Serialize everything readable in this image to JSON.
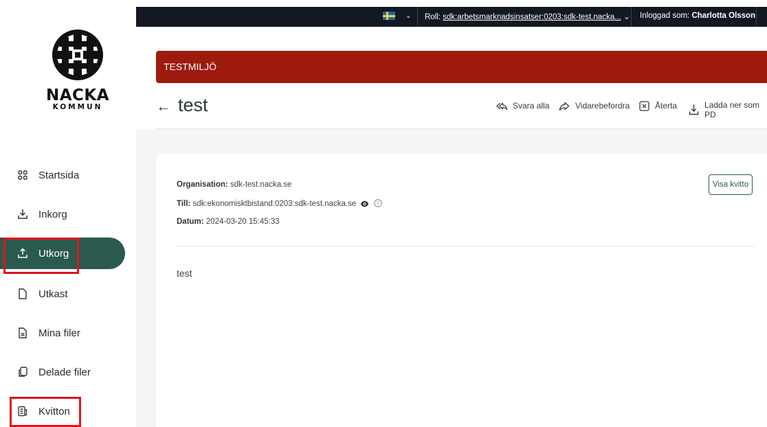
{
  "logo": {
    "name": "NACKA",
    "sub": "KOMMUN"
  },
  "sidebar": {
    "items": [
      {
        "label": "Startsida",
        "icon": "grid-icon"
      },
      {
        "label": "Inkorg",
        "icon": "inbox-icon"
      },
      {
        "label": "Utkorg",
        "icon": "outbox-icon",
        "active": true
      },
      {
        "label": "Utkast",
        "icon": "draft-file-icon"
      },
      {
        "label": "Mina filer",
        "icon": "file-icon"
      },
      {
        "label": "Delade filer",
        "icon": "shared-files-icon"
      },
      {
        "label": "Kvitton",
        "icon": "receipt-icon"
      }
    ]
  },
  "topbar": {
    "role_label": "Roll:",
    "role_value": "sdk:arbetsmarknadsinsatser:0203:sdk-test.nacka...",
    "login_label": "Inloggad som:",
    "user": "Charlotta Olsson"
  },
  "banner": {
    "text": "TESTMILJÖ"
  },
  "page": {
    "title": "test",
    "back_arrow": "←"
  },
  "actions": {
    "reply_all": "Svara alla",
    "forward": "Vidarebefordra",
    "withdraw": "Återta",
    "download": "Ladda ner som PD"
  },
  "message": {
    "org_label": "Organisation:",
    "org_value": "sdk-test.nacka.se",
    "to_label": "Till:",
    "to_value": "sdk:ekonomisktbistand:0203:sdk-test.nacka.se",
    "date_label": "Datum:",
    "date_value": "2024-03-20 15:45:33",
    "body": "test",
    "receipt_button": "Visa kvitto"
  },
  "colors": {
    "accent": "#2a5a4f",
    "banner": "#9d1a0d",
    "topbar": "#131822",
    "highlight": "#e1141c"
  }
}
